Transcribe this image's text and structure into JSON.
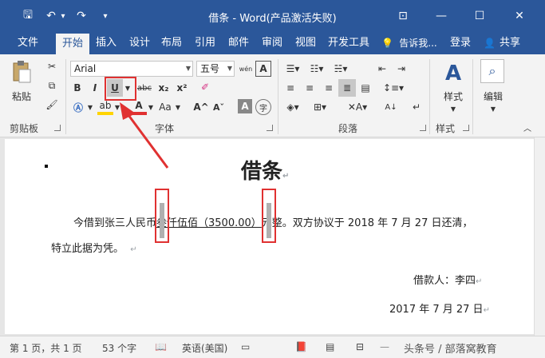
{
  "window": {
    "title": "借条 - Word(产品激活失败)",
    "quick_access": {
      "save": "🖫",
      "undo": "↶",
      "undo_dd": "▾",
      "redo": "↷",
      "customize": "▾"
    },
    "controls": {
      "ribbon_display": "⊡",
      "minimize": "—",
      "maximize": "☐",
      "close": "✕"
    }
  },
  "tabs": [
    {
      "label": "文件",
      "active": false
    },
    {
      "label": "开始",
      "active": true
    },
    {
      "label": "插入",
      "active": false
    },
    {
      "label": "设计",
      "active": false
    },
    {
      "label": "布局",
      "active": false
    },
    {
      "label": "引用",
      "active": false
    },
    {
      "label": "邮件",
      "active": false
    },
    {
      "label": "审阅",
      "active": false
    },
    {
      "label": "视图",
      "active": false
    },
    {
      "label": "开发工具",
      "active": false
    }
  ],
  "tell_me": "告诉我...",
  "login": "登录",
  "share": "共享",
  "ribbon": {
    "clipboard": {
      "paste": "粘贴",
      "label": "剪贴板"
    },
    "font": {
      "name": "Arial",
      "size": "五号",
      "wen": "wén",
      "bold": "B",
      "italic": "I",
      "underline": "U",
      "strike": "abc",
      "subscript": "x₂",
      "superscript": "x²",
      "font_color": "A",
      "change_case": "Aa",
      "grow": "A^",
      "shrink": "Aˇ",
      "char_shading": "A",
      "enclose": "字",
      "label": "字体"
    },
    "paragraph": {
      "label": "段落"
    },
    "styles": {
      "button": "样式",
      "label": "样式"
    },
    "editing": {
      "button": "编辑"
    }
  },
  "document": {
    "title": "借条",
    "line1_prefix": "今借到张三人民币",
    "line1_amount": "叁仟伍佰（3500.00）",
    "line1_suffix": "元整。双方协议于 2018 年 7 月 27 日还清，",
    "line2": "特立此据为凭。",
    "signer": "借款人：李四",
    "date": "2017 年 7 月 27 日"
  },
  "status": {
    "page": "第 1 页，共 1 页",
    "words": "53 个字",
    "language": "英语(美国)"
  },
  "watermark": "头条号 / 部落窝教育",
  "colors": {
    "accent": "#2b579a",
    "annotation": "#e03131"
  }
}
